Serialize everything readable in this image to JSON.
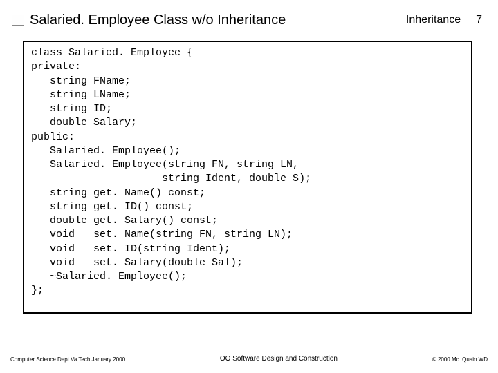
{
  "header": {
    "title": "Salaried. Employee Class w/o Inheritance",
    "topic": "Inheritance",
    "page": "7"
  },
  "code": "class Salaried. Employee {\nprivate:\n   string FName;\n   string LName;\n   string ID;\n   double Salary;\npublic:\n   Salaried. Employee();\n   Salaried. Employee(string FN, string LN,\n                     string Ident, double S);\n   string get. Name() const;\n   string get. ID() const;\n   double get. Salary() const;\n   void   set. Name(string FN, string LN);\n   void   set. ID(string Ident);\n   void   set. Salary(double Sal);\n   ~Salaried. Employee();\n};",
  "footer": {
    "left": "Computer Science Dept Va Tech January 2000",
    "center": "OO Software Design and Construction",
    "right": "© 2000  Mc. Quain WD"
  }
}
